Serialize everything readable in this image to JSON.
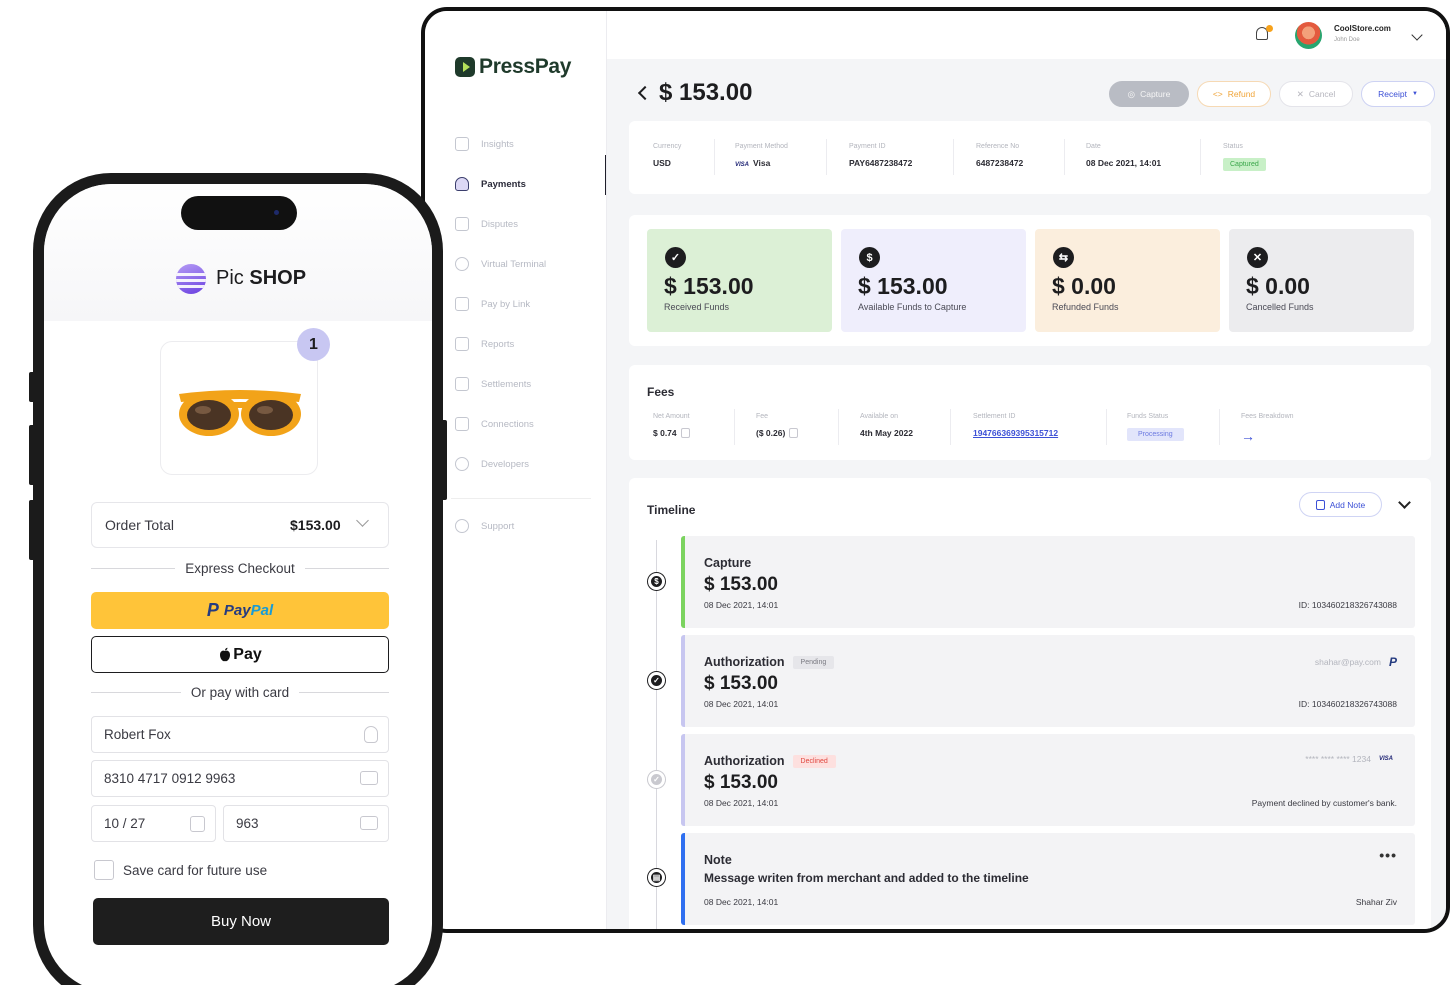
{
  "brand": {
    "name": "PressPay"
  },
  "nav": {
    "items": [
      {
        "label": "Insights"
      },
      {
        "label": "Payments"
      },
      {
        "label": "Disputes"
      },
      {
        "label": "Virtual Terminal"
      },
      {
        "label": "Pay by Link"
      },
      {
        "label": "Reports"
      },
      {
        "label": "Settlements"
      },
      {
        "label": "Connections"
      },
      {
        "label": "Developers"
      }
    ],
    "support": "Support"
  },
  "topbar": {
    "store": "CoolStore.com",
    "user": "John Doe"
  },
  "payment": {
    "title": "$ 153.00",
    "actions": {
      "capture": "Capture",
      "refund": "Refund",
      "cancel": "Cancel",
      "receipt": "Receipt"
    },
    "info": {
      "currency_label": "Currency",
      "currency": "USD",
      "method_label": "Payment Method",
      "method_brand": "VISA",
      "method": "Visa",
      "id_label": "Payment ID",
      "id": "PAY6487238472",
      "ref_label": "Reference No",
      "ref": "6487238472",
      "date_label": "Date",
      "date": "08 Dec 2021, 14:01",
      "status_label": "Status",
      "status": "Captured"
    }
  },
  "funds": [
    {
      "amount": "$ 153.00",
      "label": "Received Funds",
      "bg": "#dcf0d6",
      "icon": "check-circle-icon"
    },
    {
      "amount": "$ 153.00",
      "label": "Available Funds to Capture",
      "bg": "#efeefc",
      "icon": "dollar-circle-icon"
    },
    {
      "amount": "$ 0.00",
      "label": "Refunded Funds",
      "bg": "#fbeedd",
      "icon": "refund-circle-icon"
    },
    {
      "amount": "$ 0.00",
      "label": "Cancelled Funds",
      "bg": "#ececee",
      "icon": "x-circle-icon"
    }
  ],
  "fees": {
    "title": "Fees",
    "net_label": "Net Amount",
    "net": "$ 0.74",
    "fee_label": "Fee",
    "fee": "($ 0.26)",
    "avail_label": "Available on",
    "avail": "4th May 2022",
    "settlement_label": "Settlement ID",
    "settlement": "194766369395315712",
    "status_label": "Funds Status",
    "status": "Processing",
    "breakdown_label": "Fees Breakdown"
  },
  "timeline": {
    "title": "Timeline",
    "add_note": "Add Note",
    "entries": [
      {
        "type": "Capture",
        "amount": "$ 153.00",
        "date": "08 Dec 2021, 14:01",
        "right_bottom": "ID: 103460218326743088",
        "bar": "#7bd35f"
      },
      {
        "type": "Authorization",
        "pill": "Pending",
        "amount": "$ 153.00",
        "date": "08 Dec 2021, 14:01",
        "right_top": "shahar@pay.com",
        "right_bottom": "ID: 103460218326743088",
        "bar": "#c7c6f0"
      },
      {
        "type": "Authorization",
        "pill": "Declined",
        "amount": "$ 153.00",
        "date": "08 Dec 2021, 14:01",
        "right_top": "**** **** **** 1234",
        "right_brand": "VISA",
        "right_bottom": "Payment declined by customer's bank.",
        "bar": "#c7c6f0"
      },
      {
        "type": "Note",
        "message": "Message writen from merchant and added to the timeline",
        "date": "08 Dec 2021, 14:01",
        "right_bottom": "Shahar Ziv",
        "bar": "#2f6ff0"
      }
    ]
  },
  "shop": {
    "name_pre": "Pic",
    "name_bold": "SHOP",
    "quantity": "1",
    "order_total_label": "Order Total",
    "order_total": "$153.00",
    "express": "Express Checkout",
    "paypal_a": "Pay",
    "paypal_b": "Pal",
    "applepay": "Pay",
    "or_card": "Or pay with card",
    "name": "Robert Fox",
    "card": "8310 4717 0912 9963",
    "expiry": "10 / 27",
    "cvv": "963",
    "save": "Save card for future use",
    "buy": "Buy Now"
  }
}
